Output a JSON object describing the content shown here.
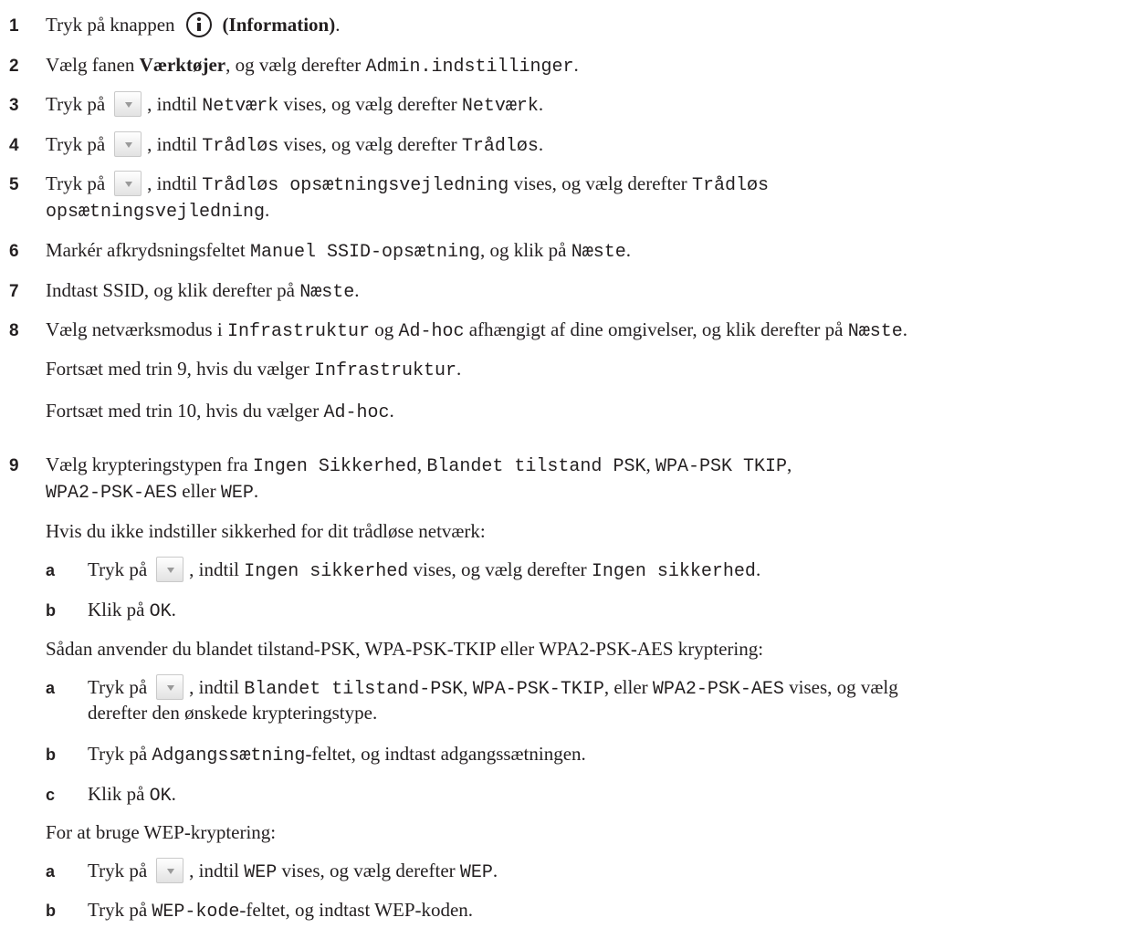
{
  "steps": {
    "s1": {
      "num": "1",
      "t1": "Tryk på knappen",
      "t2": "(Information)",
      "t3": "."
    },
    "s2": {
      "num": "2",
      "t1": "Vælg fanen ",
      "t2": "Værktøjer",
      "t3": ", og vælg derefter ",
      "m1": "Admin.indstillinger",
      "t4": "."
    },
    "s3": {
      "num": "3",
      "t1": "Tryk på",
      "t2": ", indtil ",
      "m1": "Netværk",
      "t3": " vises, og vælg derefter ",
      "m2": "Netværk",
      "t4": "."
    },
    "s4": {
      "num": "4",
      "t1": "Tryk på",
      "t2": ", indtil ",
      "m1": "Trådløs",
      "t3": " vises, og vælg derefter ",
      "m2": "Trådløs",
      "t4": "."
    },
    "s5": {
      "num": "5",
      "t1": "Tryk på",
      "t2": ", indtil ",
      "m1": "Trådløs opsætningsvejledning",
      "t3": " vises, og vælg derefter ",
      "m2": "Trådløs",
      "m3": "opsætningsvejledning",
      "t4": "."
    },
    "s6": {
      "num": "6",
      "t1": "Markér afkrydsningsfeltet ",
      "m1": "Manuel SSID-opsætning",
      "t2": ", og klik på ",
      "m2": "Næste",
      "t3": "."
    },
    "s7": {
      "num": "7",
      "t1": "Indtast SSID, og klik derefter på ",
      "m1": "Næste",
      "t2": "."
    },
    "s8": {
      "num": "8",
      "t1": "Vælg netværksmodus i ",
      "m1": "Infrastruktur",
      "t2": " og ",
      "m2": "Ad-hoc",
      "t3": " afhængigt af dine omgivelser, og klik derefter på ",
      "m3": "Næste",
      "t4": ".",
      "p1a": "Fortsæt med trin 9, hvis du vælger ",
      "p1m": "Infrastruktur",
      "p1b": ".",
      "p2a": "Fortsæt med trin 10, hvis du vælger ",
      "p2m": "Ad-hoc",
      "p2b": "."
    },
    "s9": {
      "num": "9",
      "t1": "Vælg krypteringstypen fra ",
      "m1": "Ingen Sikkerhed",
      "t2": ", ",
      "m2": "Blandet tilstand PSK",
      "t3": ", ",
      "m3": "WPA-PSK TKIP",
      "t4": ",",
      "m4": "WPA2-PSK-AES",
      "t5": " eller ",
      "m5": "WEP",
      "t6": "."
    }
  },
  "section_nosec": {
    "intro": "Hvis du ikke indstiller sikkerhed for dit trådløse netværk:",
    "a": {
      "label": "a",
      "t1": "Tryk på",
      "t2": ", indtil ",
      "m1": "Ingen sikkerhed",
      "t3": " vises, og vælg derefter ",
      "m2": "Ingen sikkerhed",
      "t4": "."
    },
    "b": {
      "label": "b",
      "t1": "Klik på ",
      "m1": "OK",
      "t2": "."
    }
  },
  "section_psk": {
    "intro": "Sådan anvender du blandet tilstand-PSK, WPA-PSK-TKIP eller WPA2-PSK-AES kryptering:",
    "a": {
      "label": "a",
      "t1": "Tryk på",
      "t2": ", indtil ",
      "m1": "Blandet tilstand-PSK",
      "t3": ", ",
      "m2": "WPA-PSK-TKIP",
      "t4": ", eller ",
      "m3": "WPA2-PSK-AES",
      "t5": " vises, og vælg",
      "line2": "derefter den ønskede krypteringstype."
    },
    "b": {
      "label": "b",
      "t1": "Tryk på ",
      "m1": "Adgangssætning",
      "t2": "-feltet, og indtast adgangssætningen."
    },
    "c": {
      "label": "c",
      "t1": "Klik på ",
      "m1": "OK",
      "t2": "."
    }
  },
  "section_wep": {
    "intro": "For at bruge WEP-kryptering:",
    "a": {
      "label": "a",
      "t1": "Tryk på",
      "t2": ", indtil ",
      "m1": "WEP",
      "t3": " vises, og vælg derefter ",
      "m2": "WEP",
      "t4": "."
    },
    "b": {
      "label": "b",
      "t1": "Tryk på ",
      "m1": "WEP-kode",
      "t2": "-feltet, og indtast WEP-koden."
    }
  }
}
